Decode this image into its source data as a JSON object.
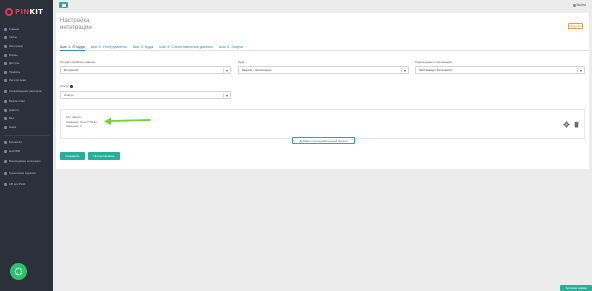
{
  "brand": {
    "name_part1": "PIN",
    "name_part2": "KIT"
  },
  "sidebar": {
    "items": [
      {
        "label": "Главная"
      },
      {
        "label": "Сайты"
      },
      {
        "label": "Интеграции"
      },
      {
        "label": "Формы"
      },
      {
        "label": "Доступы"
      },
      {
        "label": "Профиль"
      },
      {
        "label": "Интеграторам"
      },
      {
        "label": "Сопровождение партнеров"
      },
      {
        "label": "Вопрос-ответ"
      },
      {
        "label": "Новости"
      },
      {
        "label": "Блог"
      },
      {
        "label": "Акции"
      }
    ],
    "items_bottom": [
      {
        "label": "Битрикс24"
      },
      {
        "label": "amoCRM"
      },
      {
        "label": "Мессенджеры интеграция"
      },
      {
        "label": "Технические подписки"
      },
      {
        "label": "API для Pinkit"
      }
    ]
  },
  "topbar": {
    "user_label": "Выйти"
  },
  "page": {
    "title": "Настройка интеграции",
    "help_button": "Помощь"
  },
  "tabs": [
    {
      "label": "Шаг 1: Откуда"
    },
    {
      "label": "Шаг 2: Инструменты"
    },
    {
      "label": "Шаг 3: Куда"
    },
    {
      "label": "Шаг 4: Сопоставление данных"
    },
    {
      "label": "Шаг 5: Запуск"
    }
  ],
  "form": {
    "source_label": "Откуда отправлять данные",
    "source_value": "Битрикс24",
    "target_label": "Куда",
    "target_value": "Задача - обновление",
    "connection_label": "Подключение к приложению",
    "connection_value": "Мой аккаунт Битрикс24",
    "status_label": "Статус",
    "status_value": "Статус"
  },
  "rule": {
    "line1": "Тип: Запрос",
    "line2": "Название: Этап (TITLE)",
    "line3": "Значение: 3"
  },
  "buttons": {
    "add_rule": "Добавить последовательный фильтр",
    "save": "Сохранить",
    "test": "Протестировать",
    "bottom_right": "Тестовая заявка"
  },
  "colors": {
    "accent": "#26b09a",
    "arrow": "#6fd33a",
    "sidebar": "#2b303b",
    "brand": "#e03a4e"
  }
}
